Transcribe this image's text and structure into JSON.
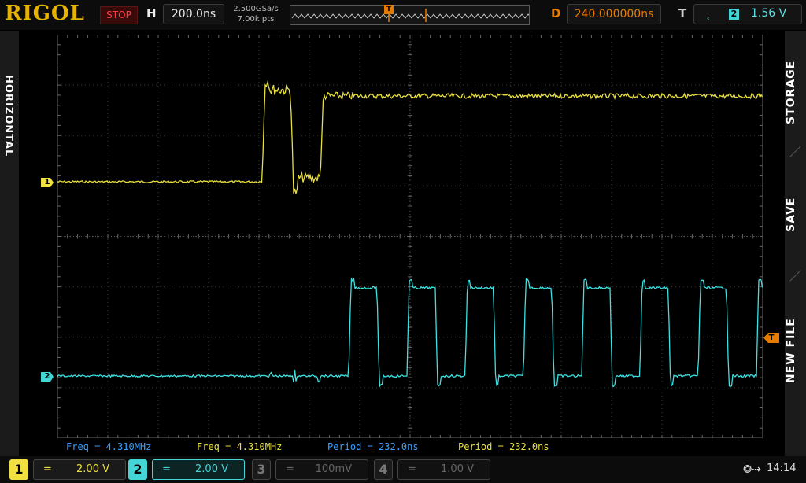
{
  "brand": "RIGOL",
  "run_status": "STOP",
  "horizontal": {
    "label": "H",
    "timebase": "200.0ns",
    "sample_rate": "2.500GSa/s",
    "memory_depth": "7.00k pts"
  },
  "delay": {
    "label": "D",
    "value": "240.000000ns"
  },
  "trigger": {
    "label": "T",
    "edge_icon": "rising-edge-icon",
    "source": "2",
    "level": "1.56 V",
    "marker": "T"
  },
  "left_menu": {
    "label": "HORIZONTAL"
  },
  "right_menu": [
    "STORAGE",
    "SAVE",
    "NEW FILE"
  ],
  "markers": {
    "ch1": "1",
    "ch2": "2",
    "trigger_top": "T",
    "trigger_right": "T"
  },
  "measurements": [
    {
      "text": "Freq = 4.310MHz",
      "color": "#3aa0ff"
    },
    {
      "text": "Freq = 4.310MHz",
      "color": "#e8e040"
    },
    {
      "text": "Period = 232.0ns",
      "color": "#3aa0ff"
    },
    {
      "text": "Period = 232.0ns",
      "color": "#e8e040"
    }
  ],
  "channels": [
    {
      "num": "1",
      "coupling": "=",
      "scale": "2.00 V",
      "color": "#f0e040",
      "active": false,
      "enabled": true
    },
    {
      "num": "2",
      "coupling": "=",
      "scale": "2.00 V",
      "color": "#44d6d6",
      "active": true,
      "enabled": true
    },
    {
      "num": "3",
      "coupling": "=",
      "scale": "100mV",
      "color": "#777777",
      "active": false,
      "enabled": false
    },
    {
      "num": "4",
      "coupling": "=",
      "scale": "1.00 V",
      "color": "#777777",
      "active": false,
      "enabled": false
    }
  ],
  "clock": "14:14",
  "colors": {
    "ch1": "#e8e040",
    "ch2": "#3ee0e0",
    "accent": "#e67b00",
    "grid": "#3a3a3a"
  }
}
